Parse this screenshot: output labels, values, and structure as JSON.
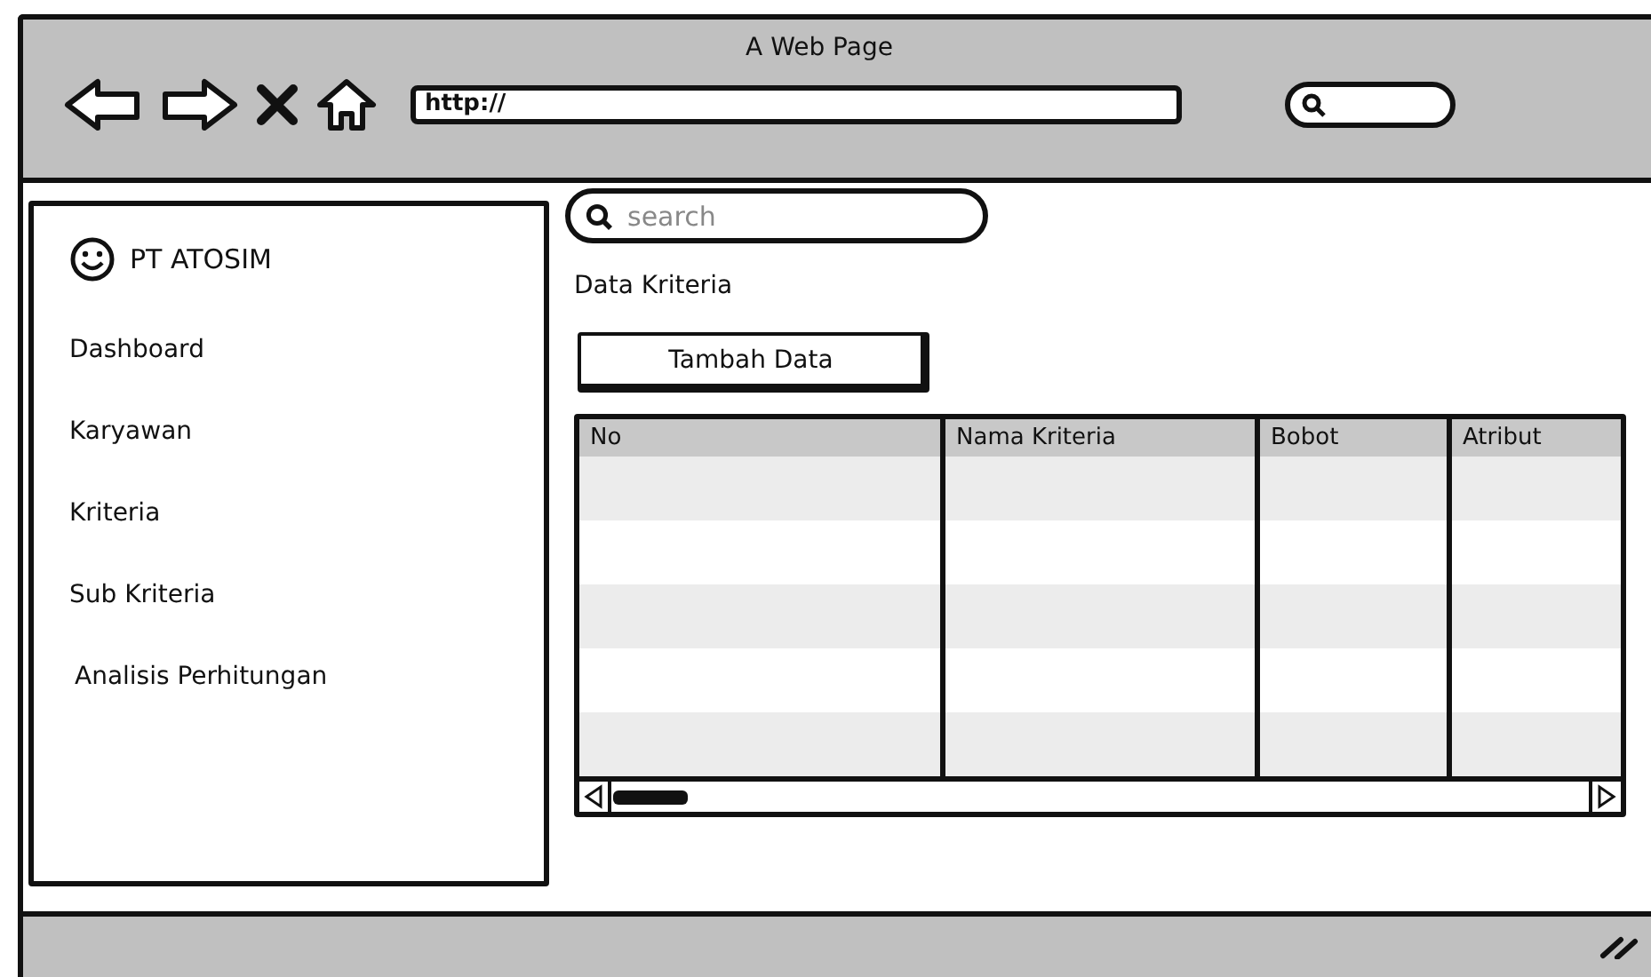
{
  "window": {
    "title": "A Web Page"
  },
  "browser": {
    "url": "http://"
  },
  "sidebar": {
    "brand": "PT ATOSIM",
    "items": [
      {
        "label": "Dashboard"
      },
      {
        "label": "Karyawan"
      },
      {
        "label": "Kriteria"
      },
      {
        "label": "Sub Kriteria"
      },
      {
        "label": "Analisis Perhitungan"
      }
    ]
  },
  "search": {
    "placeholder": "search"
  },
  "heading": "Data Kriteria",
  "add_button": "Tambah Data",
  "table": {
    "columns": [
      "No",
      "Nama Kriteria",
      "Bobot",
      "Atribut"
    ]
  }
}
